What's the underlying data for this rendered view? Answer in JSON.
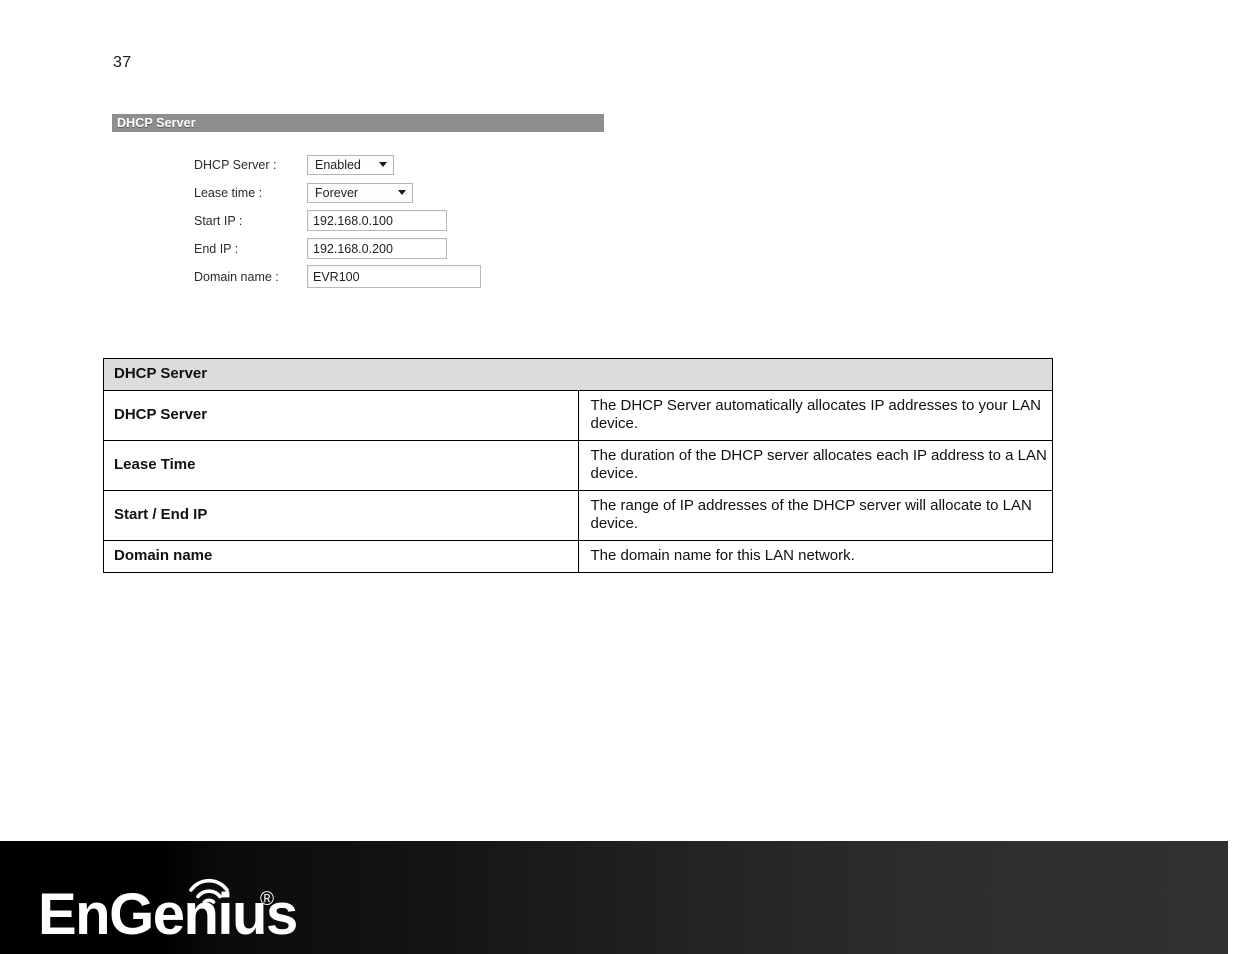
{
  "page": {
    "number": "37"
  },
  "figure": {
    "panel_title": "DHCP Server",
    "fields": [
      {
        "label": "DHCP Server :",
        "control": "select",
        "value": "Enabled",
        "icon": "chevron-down-icon"
      },
      {
        "label": "Lease time :",
        "control": "select",
        "value": "Forever",
        "icon": "chevron-down-icon"
      },
      {
        "label": "Start IP :",
        "control": "text",
        "value": "192.168.0.100"
      },
      {
        "label": "End IP :",
        "control": "text",
        "value": "192.168.0.200"
      },
      {
        "label": "Domain name :",
        "control": "text",
        "value": "EVR100"
      }
    ]
  },
  "description_table": {
    "section_title": "DHCP Server",
    "rows": [
      {
        "term": "DHCP Server",
        "description": "The DHCP Server automatically allocates IP addresses to your LAN device."
      },
      {
        "term": "Lease Time",
        "description": "The duration of the DHCP server allocates each IP address to a LAN device."
      },
      {
        "term": "Start / End IP",
        "description": "The range of IP addresses of the DHCP server will allocate to LAN device."
      },
      {
        "term": "Domain name",
        "description": "The domain name for this LAN network."
      }
    ]
  },
  "footer": {
    "brand": "EnGenius",
    "registered_mark": "®",
    "wifi_icon": "wifi-signal-icon",
    "band_color": "#000000",
    "band_color_end": "#313131"
  }
}
